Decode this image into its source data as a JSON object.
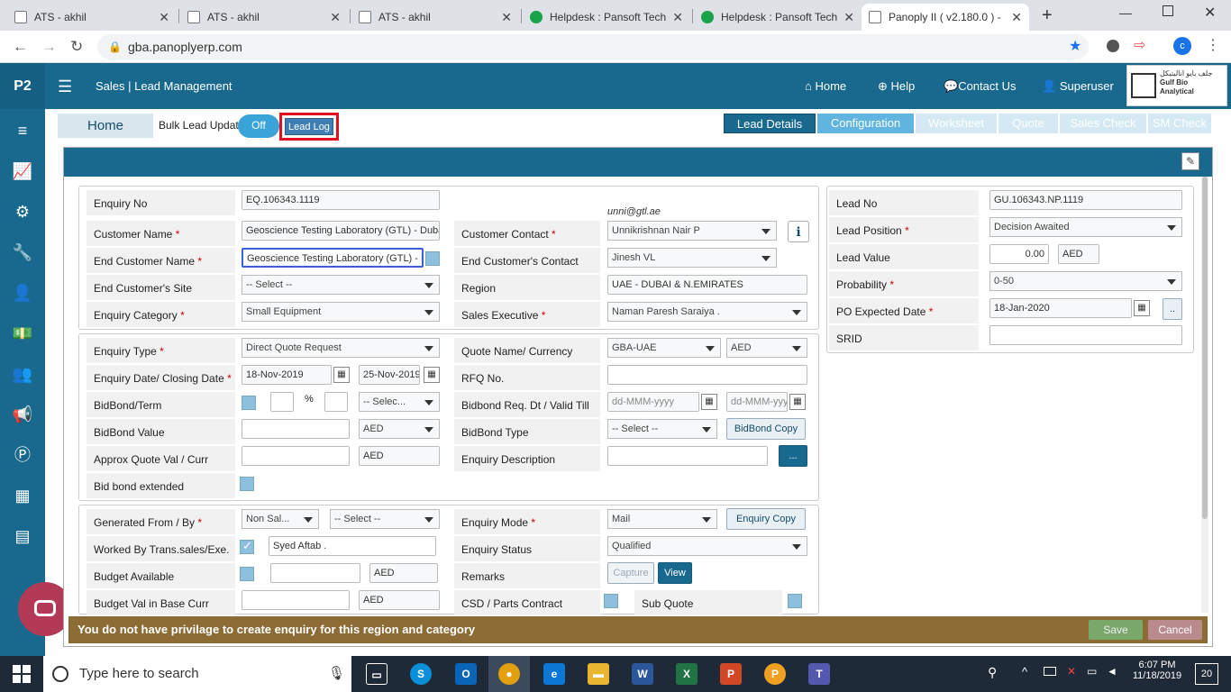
{
  "browser": {
    "tabs": [
      {
        "title": "ATS - akhil"
      },
      {
        "title": "ATS - akhil"
      },
      {
        "title": "ATS - akhil"
      },
      {
        "title": "Helpdesk : Pansoft Tech"
      },
      {
        "title": "Helpdesk : Pansoft Tech"
      },
      {
        "title": "Panoply II ( v2.180.0 ) -"
      }
    ],
    "url": "gba.panoplyerp.com",
    "profile_initial": "c"
  },
  "header": {
    "logo": "P2",
    "breadcrumb": "Sales  |  Lead Management",
    "nav": {
      "home": "Home",
      "help": "Help",
      "contact": "Contact Us",
      "user": "Superuser"
    },
    "company_arabic": "جلف بايو اناليتيكل",
    "company_name": "Gulf Bio Analytical"
  },
  "subheader": {
    "home": "Home",
    "bulk_label": "Bulk Lead Update",
    "toggle": "Off",
    "lead_log": "Lead Log",
    "tabs": [
      {
        "label": "Lead Details",
        "state": "active"
      },
      {
        "label": "Configuration",
        "state": "normal"
      },
      {
        "label": "Worksheet",
        "state": "disabled"
      },
      {
        "label": "Quote",
        "state": "disabled"
      },
      {
        "label": "Sales Check",
        "state": "disabled"
      },
      {
        "label": "SM Check",
        "state": "disabled"
      }
    ]
  },
  "form": {
    "enquiry_no": {
      "label": "Enquiry No",
      "value": "EQ.106343.1119"
    },
    "customer_name": {
      "label": "Customer Name",
      "value": "Geoscience Testing Laboratory (GTL) - Dubai"
    },
    "end_customer_name": {
      "label": "End Customer Name",
      "value": "Geoscience Testing Laboratory (GTL) - Dubai"
    },
    "end_customer_site": {
      "label": "End Customer's Site",
      "value": "-- Select --"
    },
    "enquiry_category": {
      "label": "Enquiry Category",
      "value": "Small Equipment"
    },
    "contact_email": "unni@gtl.ae",
    "customer_contact": {
      "label": "Customer Contact",
      "value": "Unnikrishnan Nair P"
    },
    "end_customer_contact": {
      "label": "End Customer's Contact",
      "value": "Jinesh VL"
    },
    "region": {
      "label": "Region",
      "value": "UAE - DUBAI & N.EMIRATES"
    },
    "sales_executive": {
      "label": "Sales Executive",
      "value": "Naman Paresh Saraiya  ."
    },
    "enquiry_type": {
      "label": "Enquiry Type",
      "value": "Direct Quote Request"
    },
    "enquiry_dates": {
      "label": "Enquiry Date/ Closing Date",
      "date": "18-Nov-2019",
      "closing": "25-Nov-2019"
    },
    "bidbond_term": {
      "label": "BidBond/Term",
      "pct": "%",
      "select": "-- Selec..."
    },
    "bidbond_value": {
      "label": "BidBond Value",
      "currency": "AED"
    },
    "approx_quote": {
      "label": "Approx Quote Val / Curr",
      "currency": "AED"
    },
    "bid_bond_extended": {
      "label": "Bid bond extended"
    },
    "quote_name": {
      "label": "Quote Name/ Currency",
      "value": "GBA-UAE",
      "currency": "AED"
    },
    "rfq_no": {
      "label": "RFQ No."
    },
    "bidbond_req": {
      "label": "Bidbond Req. Dt / Valid Till",
      "placeholder": "dd-MMM-yyyy"
    },
    "bidbond_type": {
      "label": "BidBond Type",
      "value": "-- Select --",
      "button": "BidBond Copy"
    },
    "enquiry_description": {
      "label": "Enquiry Description",
      "button": "..."
    },
    "generated_from": {
      "label": "Generated From / By",
      "value": "Non Sal...",
      "by": "-- Select --"
    },
    "worked_by": {
      "label": "Worked By Trans.sales/Exe.",
      "value": "Syed Aftab ."
    },
    "budget_available": {
      "label": "Budget Available",
      "currency": "AED"
    },
    "budget_val": {
      "label": "Budget Val in Base Curr",
      "currency": "AED"
    },
    "enquiry_mode": {
      "label": "Enquiry Mode",
      "value": "Mail",
      "button": "Enquiry Copy"
    },
    "enquiry_status": {
      "label": "Enquiry Status",
      "value": "Qualified"
    },
    "remarks": {
      "label": "Remarks",
      "capture": "Capture",
      "view": "View"
    },
    "csd": {
      "label": "CSD / Parts Contract"
    },
    "sub_quote": {
      "label": "Sub Quote"
    },
    "lead_no": {
      "label": "Lead No",
      "value": "GU.106343.NP.1119"
    },
    "lead_position": {
      "label": "Lead Position",
      "value": "Decision Awaited"
    },
    "lead_value": {
      "label": "Lead Value",
      "value": "0.00",
      "currency": "AED"
    },
    "probability": {
      "label": "Probability",
      "value": "0-50"
    },
    "po_expected": {
      "label": "PO Expected Date",
      "value": "18-Jan-2020",
      "button": ".."
    },
    "srid": {
      "label": "SRID"
    }
  },
  "message": "You do not have privilage to create enquiry for this region and category",
  "actions": {
    "save": "Save",
    "cancel": "Cancel"
  },
  "taskbar": {
    "search": "Type here to search",
    "time": "6:07 PM",
    "date": "11/18/2019",
    "notifications": "20"
  }
}
